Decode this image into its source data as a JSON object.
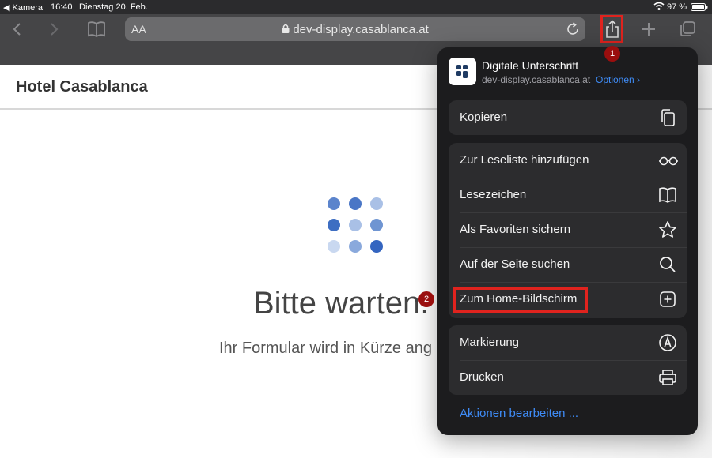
{
  "status_bar": {
    "back_app": "◀ Kamera",
    "time": "16:40",
    "date": "Dienstag 20. Feb.",
    "battery": "97 %"
  },
  "toolbar": {
    "text_size_label": "AA",
    "url": "dev-display.casablanca.at"
  },
  "page": {
    "site_title": "Hotel Casablanca",
    "wait_heading": "Bitte warten.",
    "wait_sub": "Ihr Formular wird in Kürze ang",
    "loader_colors": [
      "#5b84cc",
      "#4a76c6",
      "#a9c0e6",
      "#3e6ec2",
      "#a9c0e6",
      "#6f95d2",
      "#c9d8f0",
      "#8aa9dc",
      "#3465c0"
    ]
  },
  "share_sheet": {
    "title": "Digitale Unterschrift",
    "url": "dev-display.casablanca.at",
    "options_label": "Optionen ›",
    "groups": [
      [
        {
          "label": "Kopieren",
          "icon": "copy-icon"
        }
      ],
      [
        {
          "label": "Zur Leseliste hinzufügen",
          "icon": "glasses-icon"
        },
        {
          "label": "Lesezeichen",
          "icon": "book-icon"
        },
        {
          "label": "Als Favoriten sichern",
          "icon": "star-icon"
        },
        {
          "label": "Auf der Seite suchen",
          "icon": "search-icon"
        },
        {
          "label": "Zum Home-Bildschirm",
          "icon": "add-square-icon"
        }
      ],
      [
        {
          "label": "Markierung",
          "icon": "markup-icon"
        },
        {
          "label": "Drucken",
          "icon": "printer-icon"
        }
      ]
    ],
    "edit_actions_label": "Aktionen bearbeiten ..."
  },
  "annotations": {
    "badge_1": "1",
    "badge_2": "2",
    "highlight_color": "#e0231e"
  },
  "colors": {
    "toolbar_bg": "#454547",
    "sheet_bg": "#1c1c1e",
    "sheet_group_bg": "#2c2c2e",
    "link_blue": "#3f8cf7"
  }
}
